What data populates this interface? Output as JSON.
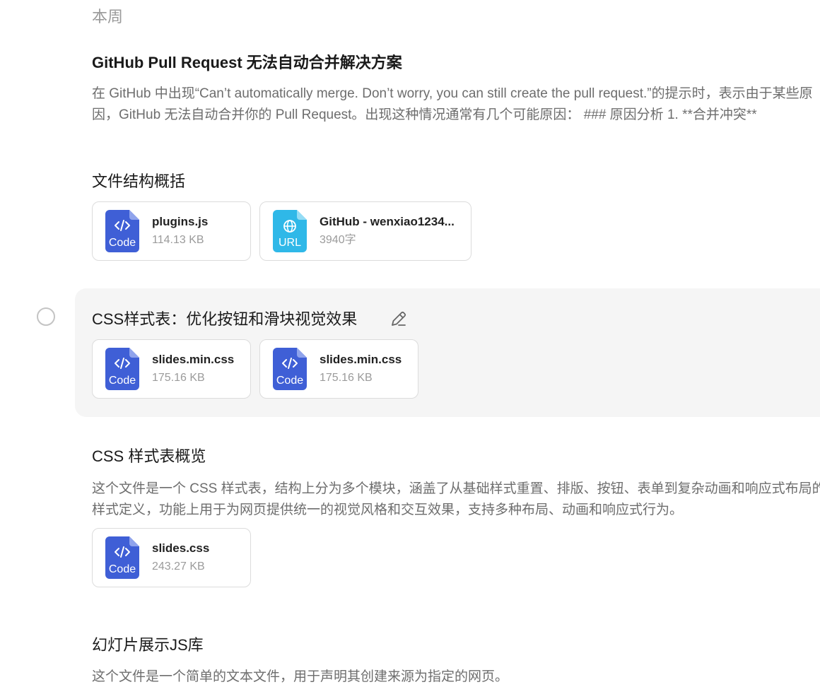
{
  "section_label": "本周",
  "conversations": [
    {
      "title": "GitHub Pull Request 无法自动合并解决方案",
      "summary_lines": [
        "在 GitHub 中出现“Can’t automatically merge. Don’t worry, you can still create the pull request.”的提示时，表示由于某些原",
        "因，GitHub 无法自动合并你的 Pull Request。出现这种情况通常有几个可能原因： ### 原因分析 1. **合并冲突**"
      ]
    },
    {
      "title": "文件结构概括",
      "files": [
        {
          "name": "plugins.js",
          "meta": "114.13 KB",
          "icon_type": "code-file-icon",
          "icon_label": "Code"
        },
        {
          "name": "GitHub - wenxiao1234...",
          "meta": "3940字",
          "icon_type": "url-file-icon",
          "icon_label": "URL"
        }
      ]
    },
    {
      "title": "CSS样式表：优化按钮和滑块视觉效果",
      "files": [
        {
          "name": "slides.min.css",
          "meta": "175.16 KB",
          "icon_type": "code-file-icon",
          "icon_label": "Code"
        },
        {
          "name": "slides.min.css",
          "meta": "175.16 KB",
          "icon_type": "code-file-icon",
          "icon_label": "Code"
        }
      ]
    },
    {
      "title": "CSS 样式表概览",
      "summary_lines": [
        "这个文件是一个 CSS 样式表，结构上分为多个模块，涵盖了从基础样式重置、排版、按钮、表单到复杂动画和响应式布局的",
        "样式定义，功能上用于为网页提供统一的视觉风格和交互效果，支持多种布局、动画和响应式行为。"
      ],
      "files": [
        {
          "name": "slides.css",
          "meta": "243.27 KB",
          "icon_type": "code-file-icon",
          "icon_label": "Code"
        }
      ]
    },
    {
      "title": "幻灯片展示JS库",
      "summary_lines": [
        "这个文件是一个简单的文本文件，用于声明其创建来源为指定的网页。"
      ]
    }
  ],
  "colors": {
    "code_icon": "#3f5fd6",
    "url_icon": "#2fb8e8",
    "highlight_bg": "#f5f5f5",
    "muted_text": "#6d6d6d"
  }
}
